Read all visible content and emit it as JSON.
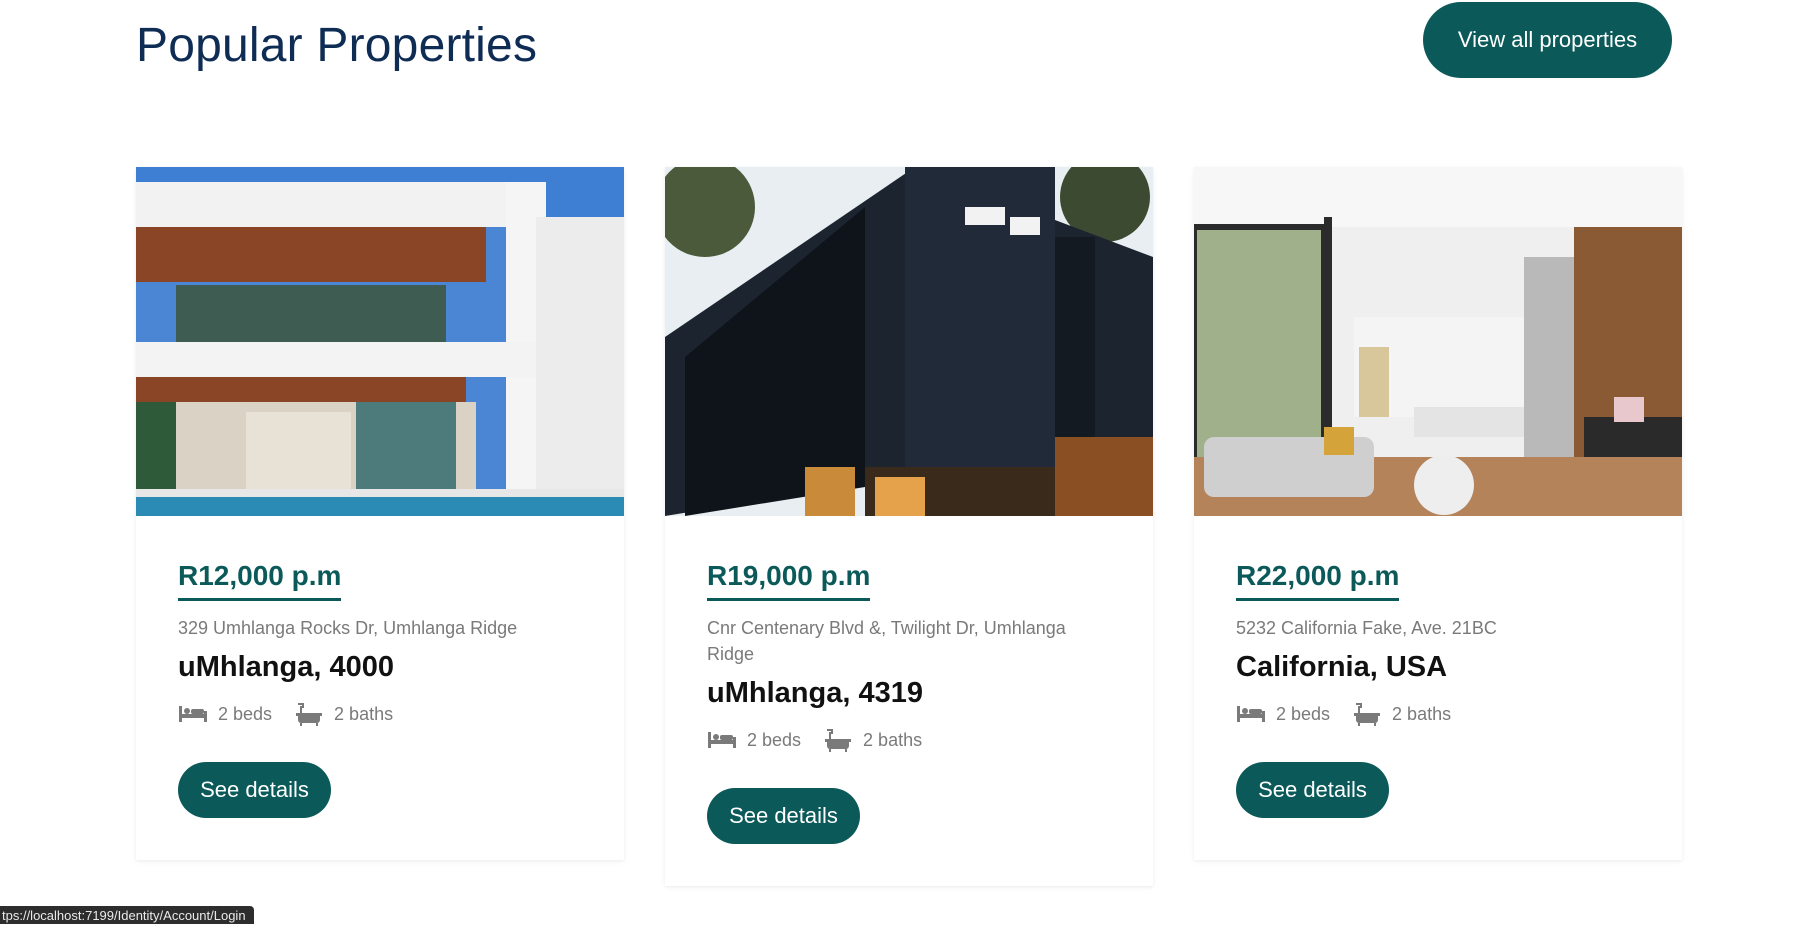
{
  "header": {
    "title": "Popular Properties",
    "view_all_label": "View all properties"
  },
  "colors": {
    "accent": "#0b5a59",
    "title": "#0f2c55",
    "muted": "#7a7a7a"
  },
  "properties": [
    {
      "price": "R12,000 p.m",
      "address": "329 Umhlanga Rocks Dr, Umhlanga Ridge",
      "city": "uMhlanga, 4000",
      "beds": "2 beds",
      "baths": "2 baths",
      "button": "See details",
      "image": "modern-white-villa-with-pool"
    },
    {
      "price": "R19,000 p.m",
      "address": "Cnr Centenary Blvd &, Twilight Dr, Umhlanga Ridge",
      "city": "uMhlanga, 4319",
      "beds": "2 beds",
      "baths": "2 baths",
      "button": "See details",
      "image": "dark-modern-house-exterior"
    },
    {
      "price": "R22,000 p.m",
      "address": "5232 California Fake, Ave. 21BC",
      "city": "California, USA",
      "beds": "2 beds",
      "baths": "2 baths",
      "button": "See details",
      "image": "open-plan-living-room-interior"
    }
  ],
  "status_bar": {
    "url": "tps://localhost:7199/Identity/Account/Login"
  }
}
